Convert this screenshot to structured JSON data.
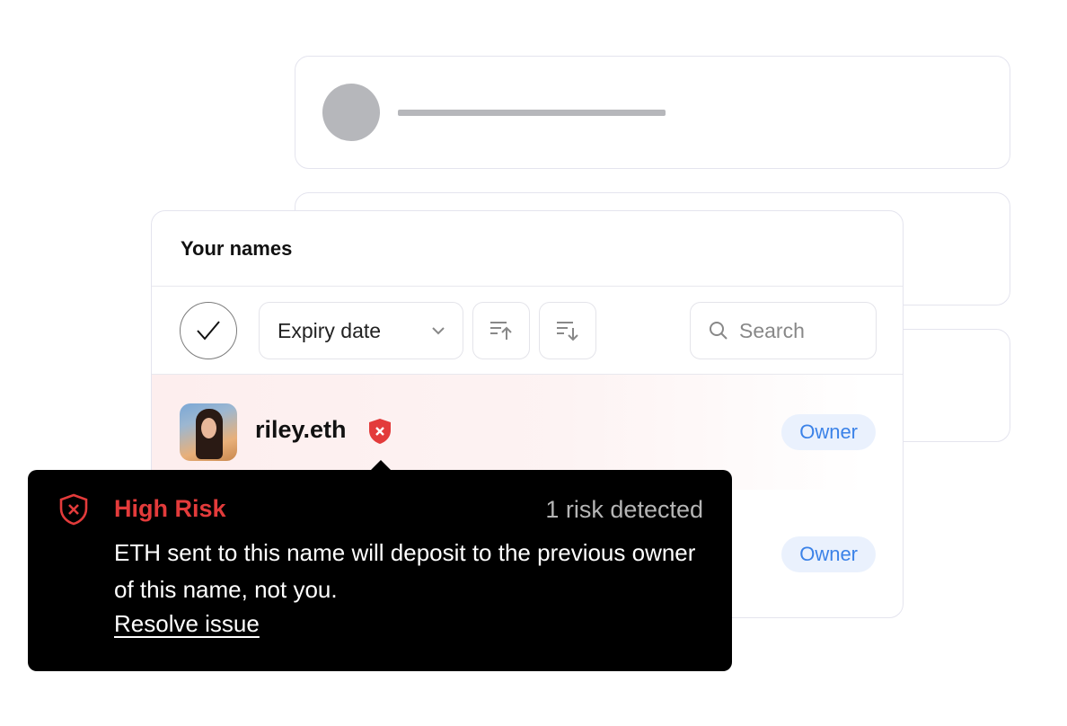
{
  "card": {
    "title": "Your names"
  },
  "toolbar": {
    "sort_label": "Expiry date",
    "search_placeholder": "Search"
  },
  "rows": [
    {
      "name": "riley.eth",
      "role": "Owner",
      "risk": true
    },
    {
      "name": "",
      "role": "Owner",
      "risk": false
    }
  ],
  "tooltip": {
    "title": "High Risk",
    "count": "1 risk detected",
    "body": "ETH sent to this name will deposit to the previous owner of this name, not you.",
    "link": "Resolve issue"
  },
  "colors": {
    "risk_red": "#e33b3b",
    "owner_blue": "#3b82e8",
    "owner_bg": "#eaf1fd",
    "skeleton": "#b6b7bb"
  }
}
